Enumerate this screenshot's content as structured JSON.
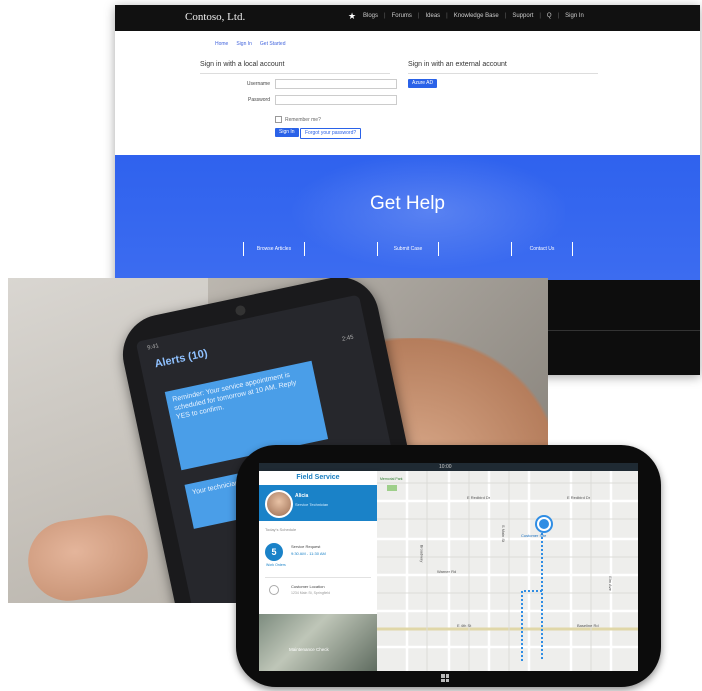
{
  "portal": {
    "brand": "Contoso, Ltd.",
    "nav_links": [
      "Blogs",
      "Forums",
      "Ideas",
      "Knowledge Base",
      "Support",
      "Q",
      "Sign In"
    ],
    "breadcrumbs": [
      "Home",
      "Sign In",
      "Get Started"
    ],
    "local_title": "Sign in with a local account",
    "external_title": "Sign in with an external account",
    "username_label": "Username",
    "password_label": "Password",
    "remember_label": "Remember me?",
    "login_button": "Sign In",
    "forgot_button": "Forgot your password?",
    "external_button": "Azure AD",
    "hero_title": "Get Help",
    "hero_links": [
      "Browse Articles",
      "Submit Case",
      "Contact Us"
    ]
  },
  "phone": {
    "status": "9:41",
    "app_title": "Alerts (10)",
    "time": "2:45",
    "bubble1": "Reminder: Your service appointment is scheduled for tomorrow at 10 AM. Reply YES to confirm.",
    "bubble2": "Your technician is on the way."
  },
  "tablet": {
    "status_time": "10:00",
    "app_title": "Field Service",
    "user_name": "Alicia",
    "user_role": "Service Technician",
    "section_label": "Today's Schedule",
    "job_badge": "5",
    "job_badge_sub": "Work Orders",
    "job_title": "Service Request",
    "job_time": "9:30 AM - 11:30 AM",
    "location_title": "Customer Location",
    "location_sub": "1234 Main St, Springfield",
    "photo_caption": "Maintenance Check",
    "map_pin_label": "Customer Site",
    "park_label": "Memorial Park",
    "streets": [
      "E Redbird Dr",
      "Broadway",
      "E Redbird Dr",
      "Warner Rd",
      "E 4th St",
      "S Main St",
      "Baseline Rd",
      "Elm Ave"
    ]
  }
}
